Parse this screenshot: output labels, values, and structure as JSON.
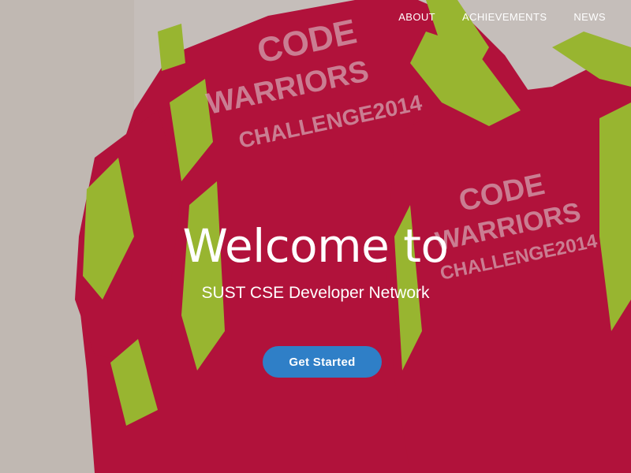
{
  "nav": {
    "items": [
      {
        "label": "ABOUT"
      },
      {
        "label": "ACHIEVEMENTS"
      },
      {
        "label": "NEWS"
      }
    ]
  },
  "hero": {
    "title": "Welcome to",
    "subtitle": "SUST CSE Developer Network",
    "cta_label": "Get Started",
    "background_image": {
      "jersey_print_left": [
        "CODE",
        "WARRIORS",
        "CHALLENGE2014"
      ],
      "jersey_print_right": [
        "CODE",
        "WARRIORS",
        "CHALLENGE2014"
      ]
    }
  },
  "colors": {
    "jersey_red": "#c2133f",
    "jersey_green": "#a6cc33",
    "wall": "#d9d7d0",
    "cta_blue": "#2f7fc7",
    "text": "#ffffff"
  }
}
